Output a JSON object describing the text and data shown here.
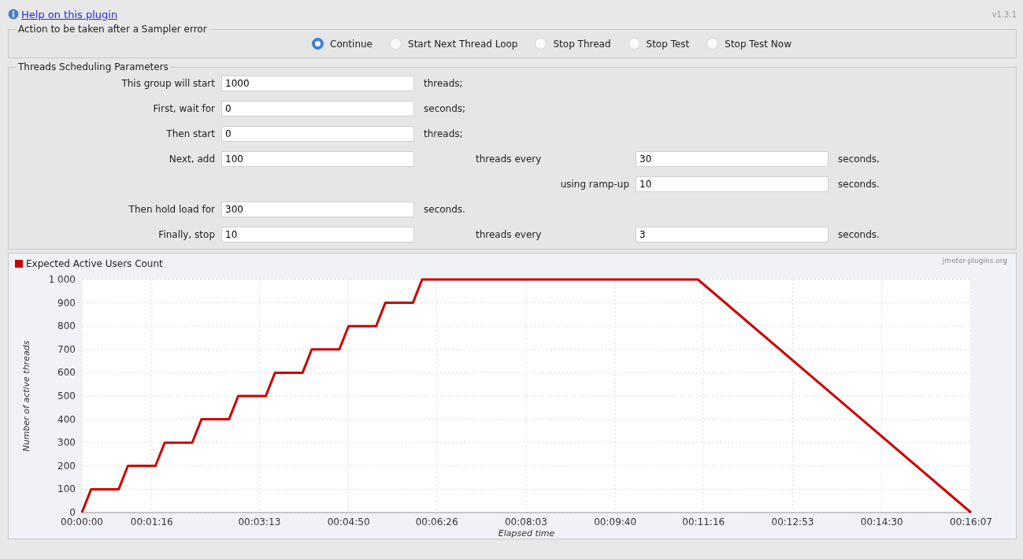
{
  "help_link": "Help on this plugin",
  "version": "v1.3.1",
  "error_action": {
    "title": "Action to be taken after a Sampler error",
    "options": [
      {
        "label": "Continue",
        "selected": true
      },
      {
        "label": "Start Next Thread Loop",
        "selected": false
      },
      {
        "label": "Stop Thread",
        "selected": false
      },
      {
        "label": "Stop Test",
        "selected": false
      },
      {
        "label": "Stop Test Now",
        "selected": false
      }
    ]
  },
  "scheduling": {
    "title": "Threads Scheduling Parameters",
    "rows": [
      {
        "kind": "single",
        "label": "This group will start",
        "value": "1000",
        "unit": "threads;"
      },
      {
        "kind": "single",
        "label": "First, wait for",
        "value": "0",
        "unit": "seconds;"
      },
      {
        "kind": "single",
        "label": "Then start",
        "value": "0",
        "unit": "threads;"
      },
      {
        "kind": "double",
        "label": "Next, add",
        "value": "100",
        "unit": "threads every",
        "value2": "30",
        "unit2": "seconds,"
      },
      {
        "kind": "sub",
        "label": "using ramp-up",
        "value": "10",
        "unit": "seconds."
      },
      {
        "kind": "single",
        "label": "Then hold load for",
        "value": "300",
        "unit": "seconds."
      },
      {
        "kind": "double",
        "label": "Finally, stop",
        "value": "10",
        "unit": "threads every",
        "value2": "3",
        "unit2": "seconds."
      }
    ]
  },
  "chart": {
    "credit": "jmeter-plugins.org",
    "chart_data": {
      "type": "line",
      "xlabel": "Elapsed time",
      "ylabel": "Number of active threads",
      "x": [
        0,
        10,
        40,
        50,
        80,
        90,
        120,
        130,
        160,
        170,
        200,
        210,
        240,
        250,
        280,
        290,
        320,
        330,
        360,
        370,
        670,
        967
      ],
      "series": [
        {
          "name": "Expected Active Users Count",
          "color": "#cc0000",
          "values": [
            0,
            100,
            100,
            200,
            200,
            300,
            300,
            400,
            400,
            500,
            500,
            600,
            600,
            700,
            700,
            800,
            800,
            900,
            900,
            1000,
            1000,
            0
          ]
        }
      ],
      "grid": true,
      "xlim": [
        0,
        967
      ],
      "ylim": [
        0,
        1000
      ],
      "xticks": [
        {
          "value": 0,
          "label": "00:00:00"
        },
        {
          "value": 76,
          "label": "00:01:16"
        },
        {
          "value": 193,
          "label": "00:03:13"
        },
        {
          "value": 290,
          "label": "00:04:50"
        },
        {
          "value": 386,
          "label": "00:06:26"
        },
        {
          "value": 483,
          "label": "00:08:03"
        },
        {
          "value": 580,
          "label": "00:09:40"
        },
        {
          "value": 676,
          "label": "00:11:16"
        },
        {
          "value": 773,
          "label": "00:12:53"
        },
        {
          "value": 870,
          "label": "00:14:30"
        },
        {
          "value": 967,
          "label": "00:16:07"
        }
      ],
      "yticks": [
        0,
        100,
        200,
        300,
        400,
        500,
        600,
        700,
        800,
        900,
        {
          "value": 1000,
          "label": "1 000"
        }
      ]
    }
  }
}
